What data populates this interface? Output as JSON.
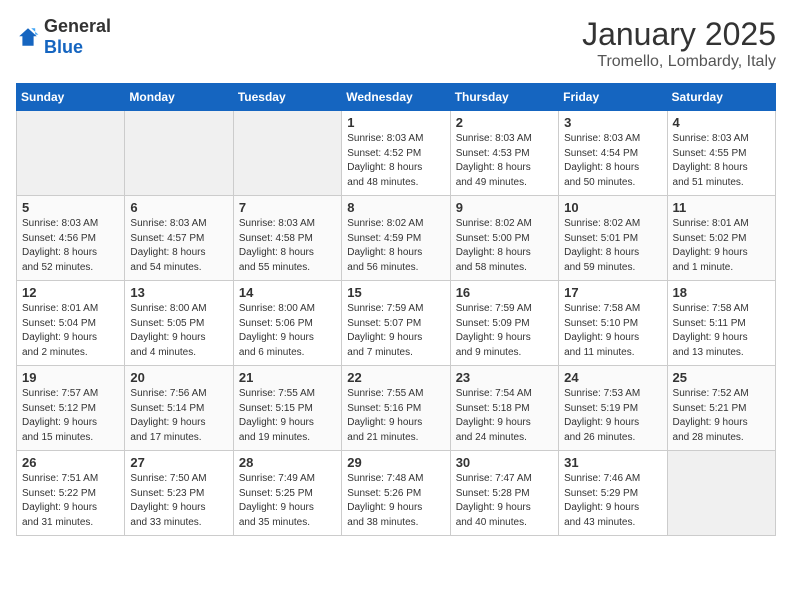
{
  "logo": {
    "general": "General",
    "blue": "Blue"
  },
  "header": {
    "month": "January 2025",
    "location": "Tromello, Lombardy, Italy"
  },
  "weekdays": [
    "Sunday",
    "Monday",
    "Tuesday",
    "Wednesday",
    "Thursday",
    "Friday",
    "Saturday"
  ],
  "weeks": [
    [
      {
        "day": "",
        "info": ""
      },
      {
        "day": "",
        "info": ""
      },
      {
        "day": "",
        "info": ""
      },
      {
        "day": "1",
        "info": "Sunrise: 8:03 AM\nSunset: 4:52 PM\nDaylight: 8 hours\nand 48 minutes."
      },
      {
        "day": "2",
        "info": "Sunrise: 8:03 AM\nSunset: 4:53 PM\nDaylight: 8 hours\nand 49 minutes."
      },
      {
        "day": "3",
        "info": "Sunrise: 8:03 AM\nSunset: 4:54 PM\nDaylight: 8 hours\nand 50 minutes."
      },
      {
        "day": "4",
        "info": "Sunrise: 8:03 AM\nSunset: 4:55 PM\nDaylight: 8 hours\nand 51 minutes."
      }
    ],
    [
      {
        "day": "5",
        "info": "Sunrise: 8:03 AM\nSunset: 4:56 PM\nDaylight: 8 hours\nand 52 minutes."
      },
      {
        "day": "6",
        "info": "Sunrise: 8:03 AM\nSunset: 4:57 PM\nDaylight: 8 hours\nand 54 minutes."
      },
      {
        "day": "7",
        "info": "Sunrise: 8:03 AM\nSunset: 4:58 PM\nDaylight: 8 hours\nand 55 minutes."
      },
      {
        "day": "8",
        "info": "Sunrise: 8:02 AM\nSunset: 4:59 PM\nDaylight: 8 hours\nand 56 minutes."
      },
      {
        "day": "9",
        "info": "Sunrise: 8:02 AM\nSunset: 5:00 PM\nDaylight: 8 hours\nand 58 minutes."
      },
      {
        "day": "10",
        "info": "Sunrise: 8:02 AM\nSunset: 5:01 PM\nDaylight: 8 hours\nand 59 minutes."
      },
      {
        "day": "11",
        "info": "Sunrise: 8:01 AM\nSunset: 5:02 PM\nDaylight: 9 hours\nand 1 minute."
      }
    ],
    [
      {
        "day": "12",
        "info": "Sunrise: 8:01 AM\nSunset: 5:04 PM\nDaylight: 9 hours\nand 2 minutes."
      },
      {
        "day": "13",
        "info": "Sunrise: 8:00 AM\nSunset: 5:05 PM\nDaylight: 9 hours\nand 4 minutes."
      },
      {
        "day": "14",
        "info": "Sunrise: 8:00 AM\nSunset: 5:06 PM\nDaylight: 9 hours\nand 6 minutes."
      },
      {
        "day": "15",
        "info": "Sunrise: 7:59 AM\nSunset: 5:07 PM\nDaylight: 9 hours\nand 7 minutes."
      },
      {
        "day": "16",
        "info": "Sunrise: 7:59 AM\nSunset: 5:09 PM\nDaylight: 9 hours\nand 9 minutes."
      },
      {
        "day": "17",
        "info": "Sunrise: 7:58 AM\nSunset: 5:10 PM\nDaylight: 9 hours\nand 11 minutes."
      },
      {
        "day": "18",
        "info": "Sunrise: 7:58 AM\nSunset: 5:11 PM\nDaylight: 9 hours\nand 13 minutes."
      }
    ],
    [
      {
        "day": "19",
        "info": "Sunrise: 7:57 AM\nSunset: 5:12 PM\nDaylight: 9 hours\nand 15 minutes."
      },
      {
        "day": "20",
        "info": "Sunrise: 7:56 AM\nSunset: 5:14 PM\nDaylight: 9 hours\nand 17 minutes."
      },
      {
        "day": "21",
        "info": "Sunrise: 7:55 AM\nSunset: 5:15 PM\nDaylight: 9 hours\nand 19 minutes."
      },
      {
        "day": "22",
        "info": "Sunrise: 7:55 AM\nSunset: 5:16 PM\nDaylight: 9 hours\nand 21 minutes."
      },
      {
        "day": "23",
        "info": "Sunrise: 7:54 AM\nSunset: 5:18 PM\nDaylight: 9 hours\nand 24 minutes."
      },
      {
        "day": "24",
        "info": "Sunrise: 7:53 AM\nSunset: 5:19 PM\nDaylight: 9 hours\nand 26 minutes."
      },
      {
        "day": "25",
        "info": "Sunrise: 7:52 AM\nSunset: 5:21 PM\nDaylight: 9 hours\nand 28 minutes."
      }
    ],
    [
      {
        "day": "26",
        "info": "Sunrise: 7:51 AM\nSunset: 5:22 PM\nDaylight: 9 hours\nand 31 minutes."
      },
      {
        "day": "27",
        "info": "Sunrise: 7:50 AM\nSunset: 5:23 PM\nDaylight: 9 hours\nand 33 minutes."
      },
      {
        "day": "28",
        "info": "Sunrise: 7:49 AM\nSunset: 5:25 PM\nDaylight: 9 hours\nand 35 minutes."
      },
      {
        "day": "29",
        "info": "Sunrise: 7:48 AM\nSunset: 5:26 PM\nDaylight: 9 hours\nand 38 minutes."
      },
      {
        "day": "30",
        "info": "Sunrise: 7:47 AM\nSunset: 5:28 PM\nDaylight: 9 hours\nand 40 minutes."
      },
      {
        "day": "31",
        "info": "Sunrise: 7:46 AM\nSunset: 5:29 PM\nDaylight: 9 hours\nand 43 minutes."
      },
      {
        "day": "",
        "info": ""
      }
    ]
  ]
}
